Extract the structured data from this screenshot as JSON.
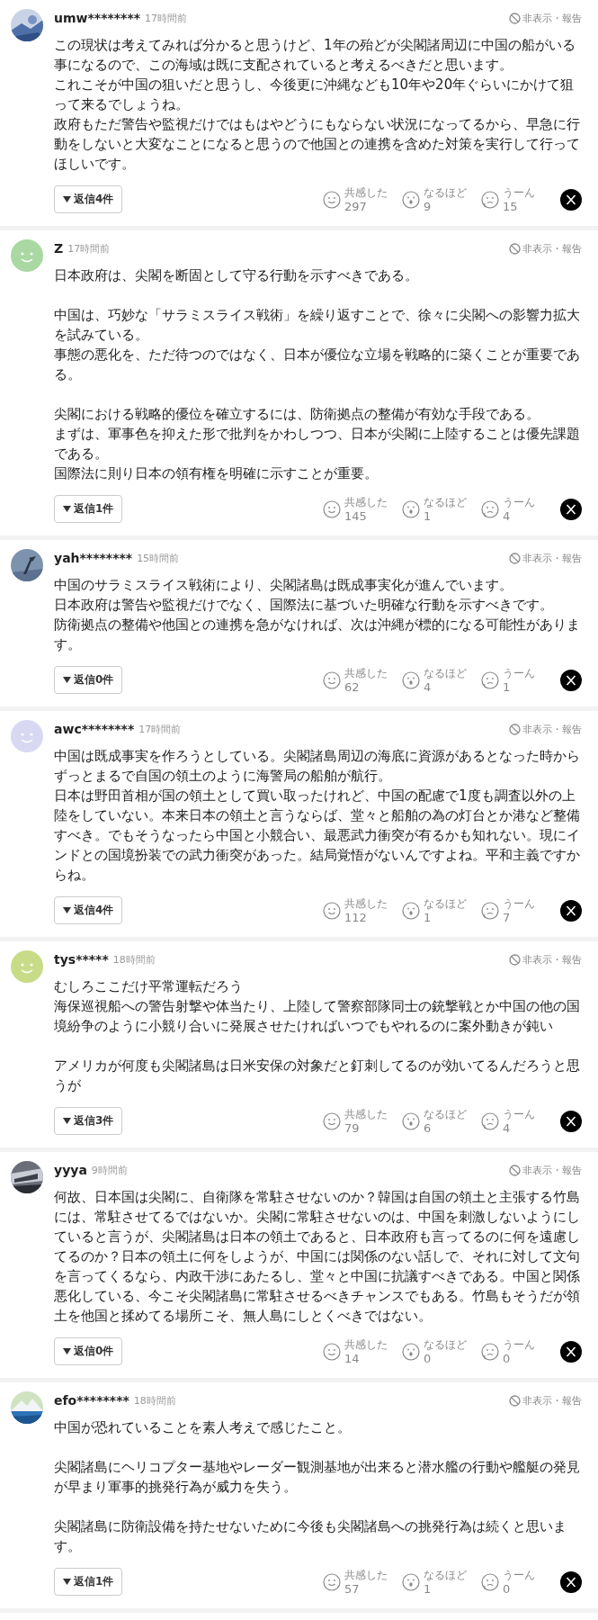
{
  "comments": [
    {
      "avatar": {
        "kind": "picture"
      },
      "user": "umw********",
      "time": "17時間前",
      "menu": "非表示・報告",
      "paragraphs": [
        [
          "この現状は考えてみれば分かると思うけど、1年の殆どが尖閣諸周辺に中国の船がいる事になるので、この海域は既に支配されていると考えるべきだと思います。",
          "これこそが中国の狙いだと思うし、今後更に沖縄なども10年や20年ぐらいにかけて狙って来るでしょうね。",
          "政府もただ警告や監視だけではもはやどうにもならない状況になってるから、早急に行動をしないと大変なことになると思うので他国との連携を含めた対策を実行して行ってほしいです。"
        ]
      ],
      "replies": "返信4件",
      "reactions": [
        {
          "kind": "smile",
          "label": "共感した",
          "count": "297"
        },
        {
          "kind": "surprise",
          "label": "なるほど",
          "count": "9"
        },
        {
          "kind": "frown",
          "label": "うーん",
          "count": "15"
        }
      ]
    },
    {
      "avatar": {
        "kind": "smiley",
        "color": "#a9d8a3"
      },
      "user": "Z",
      "time": "17時間前",
      "menu": "非表示・報告",
      "paragraphs": [
        [
          "日本政府は、尖閣を断固として守る行動を示すべきである。"
        ],
        [
          "中国は、巧妙な「サラミスライス戦術」を繰り返すことで、徐々に尖閣への影響力拡大を試みている。",
          "事態の悪化を、ただ待つのではなく、日本が優位な立場を戦略的に築くことが重要である。"
        ],
        [
          "尖閣における戦略的優位を確立するには、防衛拠点の整備が有効な手段である。",
          "まずは、軍事色を抑えた形で批判をかわしつつ、日本が尖閣に上陸することは優先課題である。",
          "国際法に則り日本の領有権を明確に示すことが重要。"
        ]
      ],
      "replies": "返信1件",
      "reactions": [
        {
          "kind": "smile",
          "label": "共感した",
          "count": "145"
        },
        {
          "kind": "surprise",
          "label": "なるほど",
          "count": "1"
        },
        {
          "kind": "frown",
          "label": "うーん",
          "count": "4"
        }
      ]
    },
    {
      "avatar": {
        "kind": "picture"
      },
      "user": "yah********",
      "time": "15時間前",
      "menu": "非表示・報告",
      "paragraphs": [
        [
          "中国のサラミスライス戦術により、尖閣諸島は既成事実化が進んでいます。",
          "日本政府は警告や監視だけでなく、国際法に基づいた明確な行動を示すべきです。",
          "防衛拠点の整備や他国との連携を急がなければ、次は沖縄が標的になる可能性があります。"
        ]
      ],
      "replies": "返信0件",
      "reactions": [
        {
          "kind": "smile",
          "label": "共感した",
          "count": "62"
        },
        {
          "kind": "surprise",
          "label": "なるほど",
          "count": "4"
        },
        {
          "kind": "frown",
          "label": "うーん",
          "count": "1"
        }
      ]
    },
    {
      "avatar": {
        "kind": "smiley",
        "color": "#d8d8f2"
      },
      "user": "awc********",
      "time": "17時間前",
      "menu": "非表示・報告",
      "paragraphs": [
        [
          "中国は既成事実を作ろうとしている。尖閣諸島周辺の海底に資源があるとなった時からずっとまるで自国の領土のように海警局の船舶が航行。",
          "日本は野田首相が国の領土として買い取ったけれど、中国の配慮で1度も調査以外の上陸をしていない。本来日本の領土と言うならば、堂々と船舶の為の灯台とか港など整備すべき。でもそうなったら中国と小競合い、最悪武力衝突が有るかも知れない。現にインドとの国境扮装での武力衝突があった。結局覚悟がないんですよね。平和主義ですからね。"
        ]
      ],
      "replies": "返信4件",
      "reactions": [
        {
          "kind": "smile",
          "label": "共感した",
          "count": "112"
        },
        {
          "kind": "surprise",
          "label": "なるほど",
          "count": "1"
        },
        {
          "kind": "frown",
          "label": "うーん",
          "count": "7"
        }
      ]
    },
    {
      "avatar": {
        "kind": "smiley",
        "color": "#c8dc88"
      },
      "user": "tys*****",
      "time": "18時間前",
      "menu": "非表示・報告",
      "paragraphs": [
        [
          "むしろここだけ平常運転だろう",
          "海保巡視船への警告射撃や体当たり、上陸して警察部隊同士の銃撃戦とか中国の他の国境紛争のように小競り合いに発展させたければいつでもやれるのに案外動きが鈍い"
        ],
        [
          "アメリカが何度も尖閣諸島は日米安保の対象だと釘刺してるのが効いてるんだろうと思うが"
        ]
      ],
      "replies": "返信3件",
      "reactions": [
        {
          "kind": "smile",
          "label": "共感した",
          "count": "79"
        },
        {
          "kind": "surprise",
          "label": "なるほど",
          "count": "6"
        },
        {
          "kind": "frown",
          "label": "うーん",
          "count": "4"
        }
      ]
    },
    {
      "avatar": {
        "kind": "picture"
      },
      "user": "yyya",
      "time": "9時間前",
      "menu": "非表示・報告",
      "paragraphs": [
        [
          "何故、日本国は尖閣に、自衛隊を常駐させないのか？韓国は自国の領土と主張する竹島には、常駐させてるではないか。尖閣に常駐させないのは、中国を刺激しないようにしていると言うが、尖閣諸島は日本の領土であると、日本政府も言ってるのに何を遠慮してるのか？日本の領土に何をしようが、中国には関係のない話しで、それに対して文句を言ってくるなら、内政干渉にあたるし、堂々と中国に抗議すべきである。中国と関係悪化している、今こそ尖閣諸島に常駐させるべきチャンスでもある。竹島もそうだが領土を他国と揉めてる場所こそ、無人島にしとくべきではない。"
        ]
      ],
      "replies": "返信0件",
      "reactions": [
        {
          "kind": "smile",
          "label": "共感した",
          "count": "14"
        },
        {
          "kind": "surprise",
          "label": "なるほど",
          "count": "0"
        },
        {
          "kind": "frown",
          "label": "うーん",
          "count": "0"
        }
      ]
    },
    {
      "avatar": {
        "kind": "picture"
      },
      "user": "efo********",
      "time": "18時間前",
      "menu": "非表示・報告",
      "paragraphs": [
        [
          "中国が恐れていることを素人考えで感じたこと。"
        ],
        [
          "尖閣諸島にヘリコプター基地やレーダー観測基地が出来ると潜水艦の行動や艦艇の発見が早まり軍事的挑発行為が威力を失う。"
        ],
        [
          "尖閣諸島に防衛設備を持たせないために今後も尖閣諸島への挑発行為は続くと思います。"
        ]
      ],
      "replies": "返信1件",
      "reactions": [
        {
          "kind": "smile",
          "label": "共感した",
          "count": "57"
        },
        {
          "kind": "surprise",
          "label": "なるほど",
          "count": "1"
        },
        {
          "kind": "frown",
          "label": "うーん",
          "count": "0"
        }
      ]
    }
  ]
}
